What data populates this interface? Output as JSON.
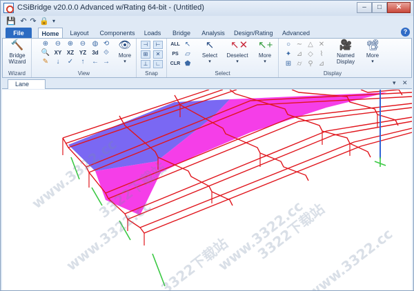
{
  "window": {
    "title": "CSiBridge v20.0.0 Advanced w/Rating 64-bit - (Untitled)",
    "controls": {
      "minimize": "–",
      "maximize": "□",
      "close": "✕"
    }
  },
  "quick_access": [
    "save-icon",
    "undo-icon",
    "redo-icon",
    "lock-icon",
    "dropdown-icon"
  ],
  "ribbon_tabs": {
    "file": "File",
    "items": [
      "Home",
      "Layout",
      "Components",
      "Loads",
      "Bridge",
      "Analysis",
      "Design/Rating",
      "Advanced"
    ],
    "active": "Home"
  },
  "help": "?",
  "ribbon": {
    "bridge_wizard": {
      "line1": "Bridge",
      "line2": "Wizard",
      "group": "Wizard"
    },
    "view": {
      "group": "View",
      "buttons": [
        "XY",
        "XZ",
        "YZ",
        "3d"
      ],
      "more": "More"
    },
    "snap": {
      "group": "Snap"
    },
    "select": {
      "group": "Select",
      "small": [
        "ALL",
        "PS",
        "CLR"
      ],
      "select_label": "Select",
      "deselect_label": "Deselect",
      "more": "More"
    },
    "display": {
      "group": "Display",
      "named_display_line1": "Named",
      "named_display_line2": "Display",
      "more": "More"
    }
  },
  "document": {
    "tab": "Lane",
    "controls": {
      "dropdown": "▾",
      "close": "✕"
    }
  },
  "watermarks": [
    "www.3322.cc",
    "3322下载站",
    "www.3322.cc",
    "3322下载站",
    "www.3322.cc",
    "3322下载站",
    "www.3322.cc"
  ],
  "colors": {
    "frame": "#e0151c",
    "lane_blue": "#6b58f2",
    "lane_magenta": "#f42ee6",
    "column": "#2f63d6",
    "support": "#39c842",
    "ribbon_active": "#2b6bc2"
  }
}
